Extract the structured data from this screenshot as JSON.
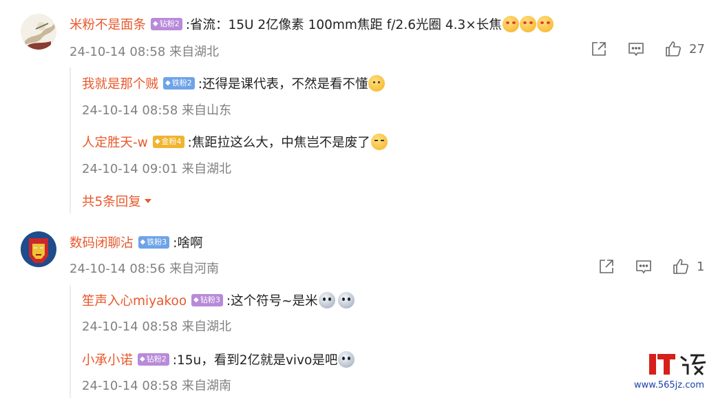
{
  "comments": [
    {
      "user": "米粉不是面条",
      "badge": "钻粉2",
      "text": ":省流：15U  2亿像素  100mm焦距  f/2.6光圈  4.3×长焦",
      "emoji": "heart-eyes-emoji",
      "time": "24-10-14 08:58 来自湖北",
      "likes": "27",
      "replies": [
        {
          "user": "我就是那个贼",
          "badge": "铁粉2",
          "text": ":还得是课代表，不然是看不懂",
          "time": "24-10-14 08:58 来自山东"
        },
        {
          "user": "人定胜天-w",
          "badge": "金粉4",
          "text": ":焦距拉这么大，中焦岂不是废了",
          "time": "24-10-14 09:01 来自湖北"
        }
      ],
      "more_label": "共5条回复"
    },
    {
      "user": "数码闭聊沾",
      "badge": "铁粉3",
      "text": ":啥啊",
      "time": "24-10-14 08:56 来自河南",
      "likes": "1",
      "replies": [
        {
          "user": "笙声入心miyakoo",
          "badge": "钻粉3",
          "text": ":这个符号~是米",
          "time": "24-10-14 08:58 来自湖北"
        },
        {
          "user": "小承小诺",
          "badge": "钻粉2",
          "text": ":15u，看到2亿就是vivo是吧",
          "time": "24-10-14 08:58 来自湖南"
        }
      ]
    }
  ],
  "watermark": {
    "text": "IT之家",
    "url": "www.565jz.com"
  },
  "colors": {
    "username": "#e8582b",
    "meta": "#808080",
    "diamond_badge": "#b88ad9",
    "iron_badge": "#6ea3e8",
    "gold_badge": "#f0b430"
  }
}
